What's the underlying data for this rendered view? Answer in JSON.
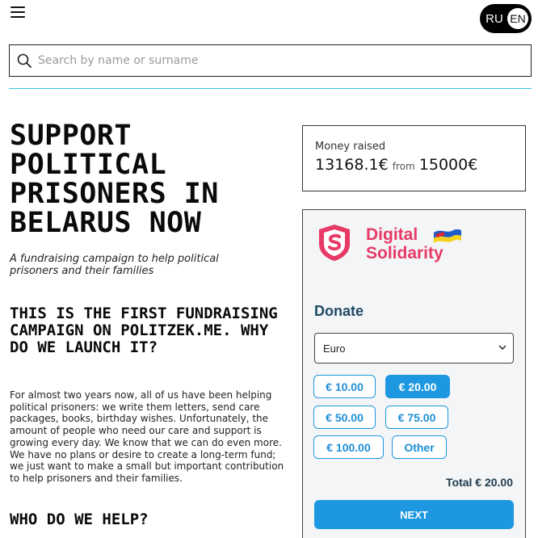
{
  "header": {
    "languages": {
      "ru": "RU",
      "en": "EN",
      "active": "EN"
    }
  },
  "search": {
    "placeholder": "Search by name or surname"
  },
  "hero": {
    "title": "Support political prisoners in Belarus now",
    "subtitle": "A fundraising campaign to help political prisoners and their families"
  },
  "sections": {
    "first_title": "This is the first fundraising campaign on politzek.me. Why do we launch it?",
    "first_body": "For almost two years now, all of us have been helping political prisoners: we write them letters, send care packages, books, birthday wishes. Unfortunately, the amount of people who need our care and support is growing every day. We know that we can do even more. We have no plans or desire to create a long-term fund; we just want to make a small but important contribution to help prisoners and their families.",
    "second_title": "Who do we help?"
  },
  "fundraising": {
    "label": "Money raised",
    "raised": "13168.1€",
    "from_word": "from",
    "goal": "15000€"
  },
  "donate": {
    "brand_line1": "Digital",
    "brand_line2": "Solidarity",
    "title": "Donate",
    "currency": "Euro",
    "amounts": [
      "€ 10.00",
      "€ 20.00",
      "€ 50.00",
      "€ 75.00",
      "€ 100.00",
      "Other"
    ],
    "selected_amount": "€ 20.00",
    "total": "Total € 20.00",
    "next_label": "NEXT"
  },
  "colors": {
    "accent": "#1d97e0",
    "brand_pink": "#e73a66",
    "divider": "#36c4e0",
    "donate_title": "#1f4a63"
  }
}
